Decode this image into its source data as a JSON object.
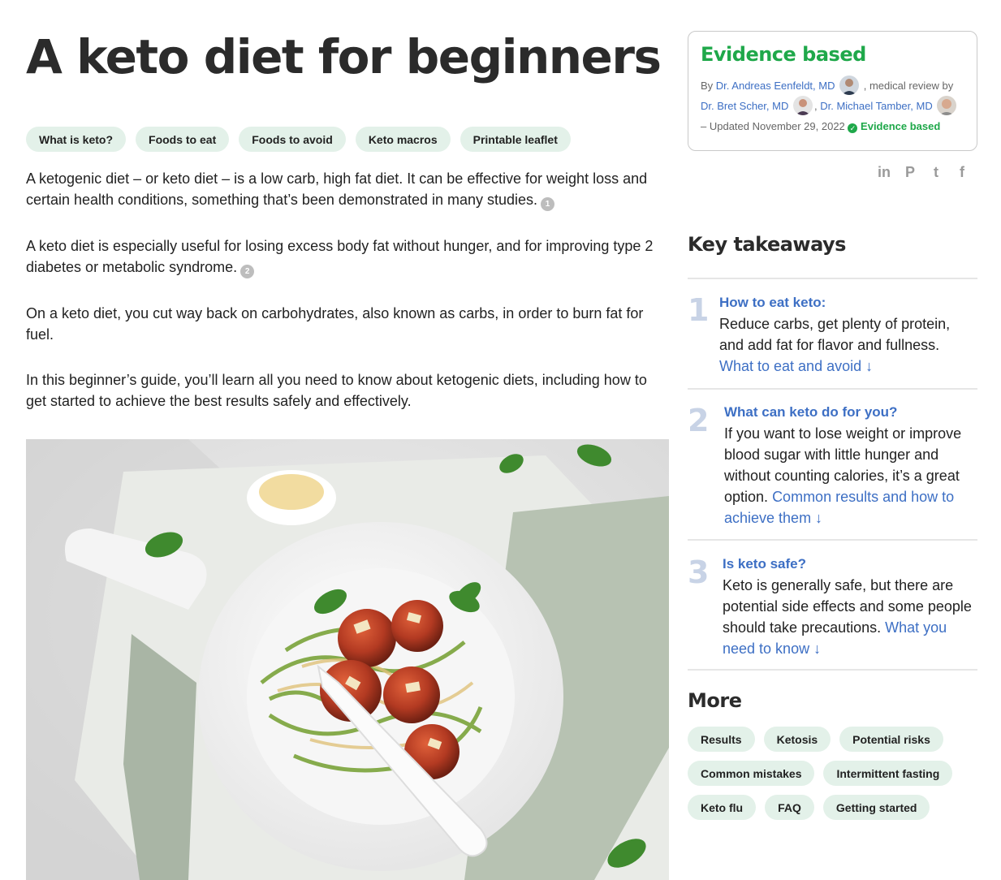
{
  "title": "A keto diet for beginners",
  "nav_pills": [
    "What is keto?",
    "Foods to eat",
    "Foods to avoid",
    "Keto macros",
    "Printable leaflet"
  ],
  "intro": [
    {
      "text": "A ketogenic diet – or keto diet – is a low carb, high fat diet. It can be effective for weight loss and certain health conditions, something that’s been demonstrated in many studies.",
      "ref": "1"
    },
    {
      "text": "A keto diet is especially useful for losing excess body fat without hunger, and for improving type 2 diabetes or metabolic syndrome.",
      "ref": "2"
    },
    {
      "text": "On a keto diet, you cut way back on carbohydrates, also known as carbs, in order to burn fat for fuel."
    },
    {
      "text": "In this beginner’s guide, you’ll learn all you need to know about ketogenic diets, including how to get started to achieve the best results safely and effectively."
    }
  ],
  "evidence": {
    "heading": "Evidence based",
    "by": "By",
    "author": "Dr. Andreas Eenfeldt, MD",
    "review": ", medical review by",
    "reviewer1": "Dr. Bret Scher, MD",
    "reviewer2": "Dr. Michael Tamber, MD",
    "updated": "– Updated November 29, 2022",
    "badge": "Evidence based"
  },
  "social": [
    "in",
    "P",
    "t",
    "f"
  ],
  "key_takeaways": {
    "heading": "Key takeaways",
    "items": [
      {
        "num": "1",
        "head": "How to eat keto:",
        "text": "Reduce carbs, get plenty of protein, and add fat for flavor and fullness.",
        "link": "What to eat and avoid ↓"
      },
      {
        "num": "2",
        "head": "What can keto do for you?",
        "text": "If you want to lose weight or improve blood sugar with little hunger and without counting calories, it’s a great option.",
        "link": "Common results and how to achieve them ↓"
      },
      {
        "num": "3",
        "head": "Is keto safe?",
        "text": "Keto is generally safe, but there are potential side effects and some people should take precautions.",
        "link": "What you need to know ↓"
      }
    ]
  },
  "more": {
    "heading": "More",
    "pills": [
      "Results",
      "Ketosis",
      "Potential risks",
      "Common mistakes",
      "Intermittent fasting",
      "Keto flu",
      "FAQ",
      "Getting started"
    ]
  }
}
